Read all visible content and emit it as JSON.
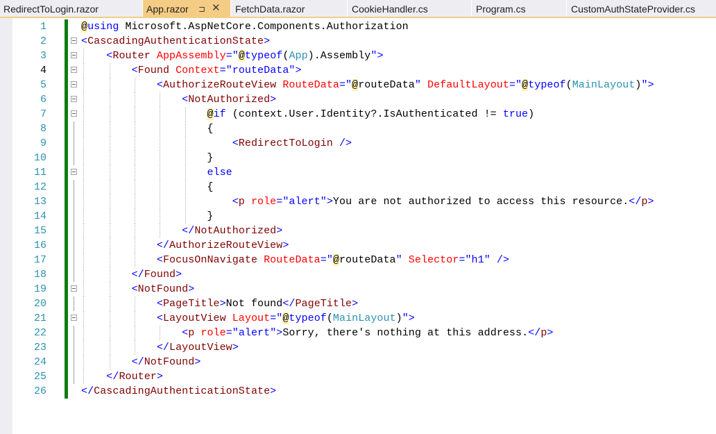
{
  "tabs": [
    {
      "label": "RedirectToLogin.razor",
      "active": false
    },
    {
      "label": "App.razor",
      "active": true,
      "pin_icon": "pin-icon",
      "close_icon": "close-icon"
    },
    {
      "label": "FetchData.razor",
      "active": false
    },
    {
      "label": "CookieHandler.cs",
      "active": false
    },
    {
      "label": "Program.cs",
      "active": false
    },
    {
      "label": "CustomAuthStateProvider.cs",
      "active": false
    }
  ],
  "pin_glyph": "⊐",
  "close_glyph": "✕",
  "current_line": 4,
  "colors": {
    "active_tab": "#f5cc84",
    "tab_strip": "#eeeef2",
    "line_number": "#2b91af",
    "change_bar": "#107c10",
    "tag": "#800000",
    "attribute": "#ff0000",
    "string": "#0000ff",
    "type": "#2b91af"
  },
  "editor": {
    "lines": [
      {
        "n": "1",
        "text": "@using Microsoft.AspNetCore.Components.Authorization"
      },
      {
        "n": "2",
        "text": "<CascadingAuthenticationState>"
      },
      {
        "n": "3",
        "text": "    <Router AppAssembly=\"@typeof(App).Assembly\">"
      },
      {
        "n": "4",
        "text": "        <Found Context=\"routeData\">"
      },
      {
        "n": "5",
        "text": "            <AuthorizeRouteView RouteData=\"@routeData\" DefaultLayout=\"@typeof(MainLayout)\">"
      },
      {
        "n": "6",
        "text": "                <NotAuthorized>"
      },
      {
        "n": "7",
        "text": "                    @if (context.User.Identity?.IsAuthenticated != true)"
      },
      {
        "n": "8",
        "text": "                    {"
      },
      {
        "n": "9",
        "text": "                        <RedirectToLogin />"
      },
      {
        "n": "10",
        "text": "                    }"
      },
      {
        "n": "11",
        "text": "                    else"
      },
      {
        "n": "12",
        "text": "                    {"
      },
      {
        "n": "13",
        "text": "                        <p role=\"alert\">You are not authorized to access this resource.</p>"
      },
      {
        "n": "14",
        "text": "                    }"
      },
      {
        "n": "15",
        "text": "                </NotAuthorized>"
      },
      {
        "n": "16",
        "text": "            </AuthorizeRouteView>"
      },
      {
        "n": "17",
        "text": "            <FocusOnNavigate RouteData=\"@routeData\" Selector=\"h1\" />"
      },
      {
        "n": "18",
        "text": "        </Found>"
      },
      {
        "n": "19",
        "text": "        <NotFound>"
      },
      {
        "n": "20",
        "text": "            <PageTitle>Not found</PageTitle>"
      },
      {
        "n": "21",
        "text": "            <LayoutView Layout=\"@typeof(MainLayout)\">"
      },
      {
        "n": "22",
        "text": "                <p role=\"alert\">Sorry, there's nothing at this address.</p>"
      },
      {
        "n": "23",
        "text": "            </LayoutView>"
      },
      {
        "n": "24",
        "text": "        </NotFound>"
      },
      {
        "n": "25",
        "text": "    </Router>"
      },
      {
        "n": "26",
        "text": "</CascadingAuthenticationState>"
      }
    ]
  }
}
